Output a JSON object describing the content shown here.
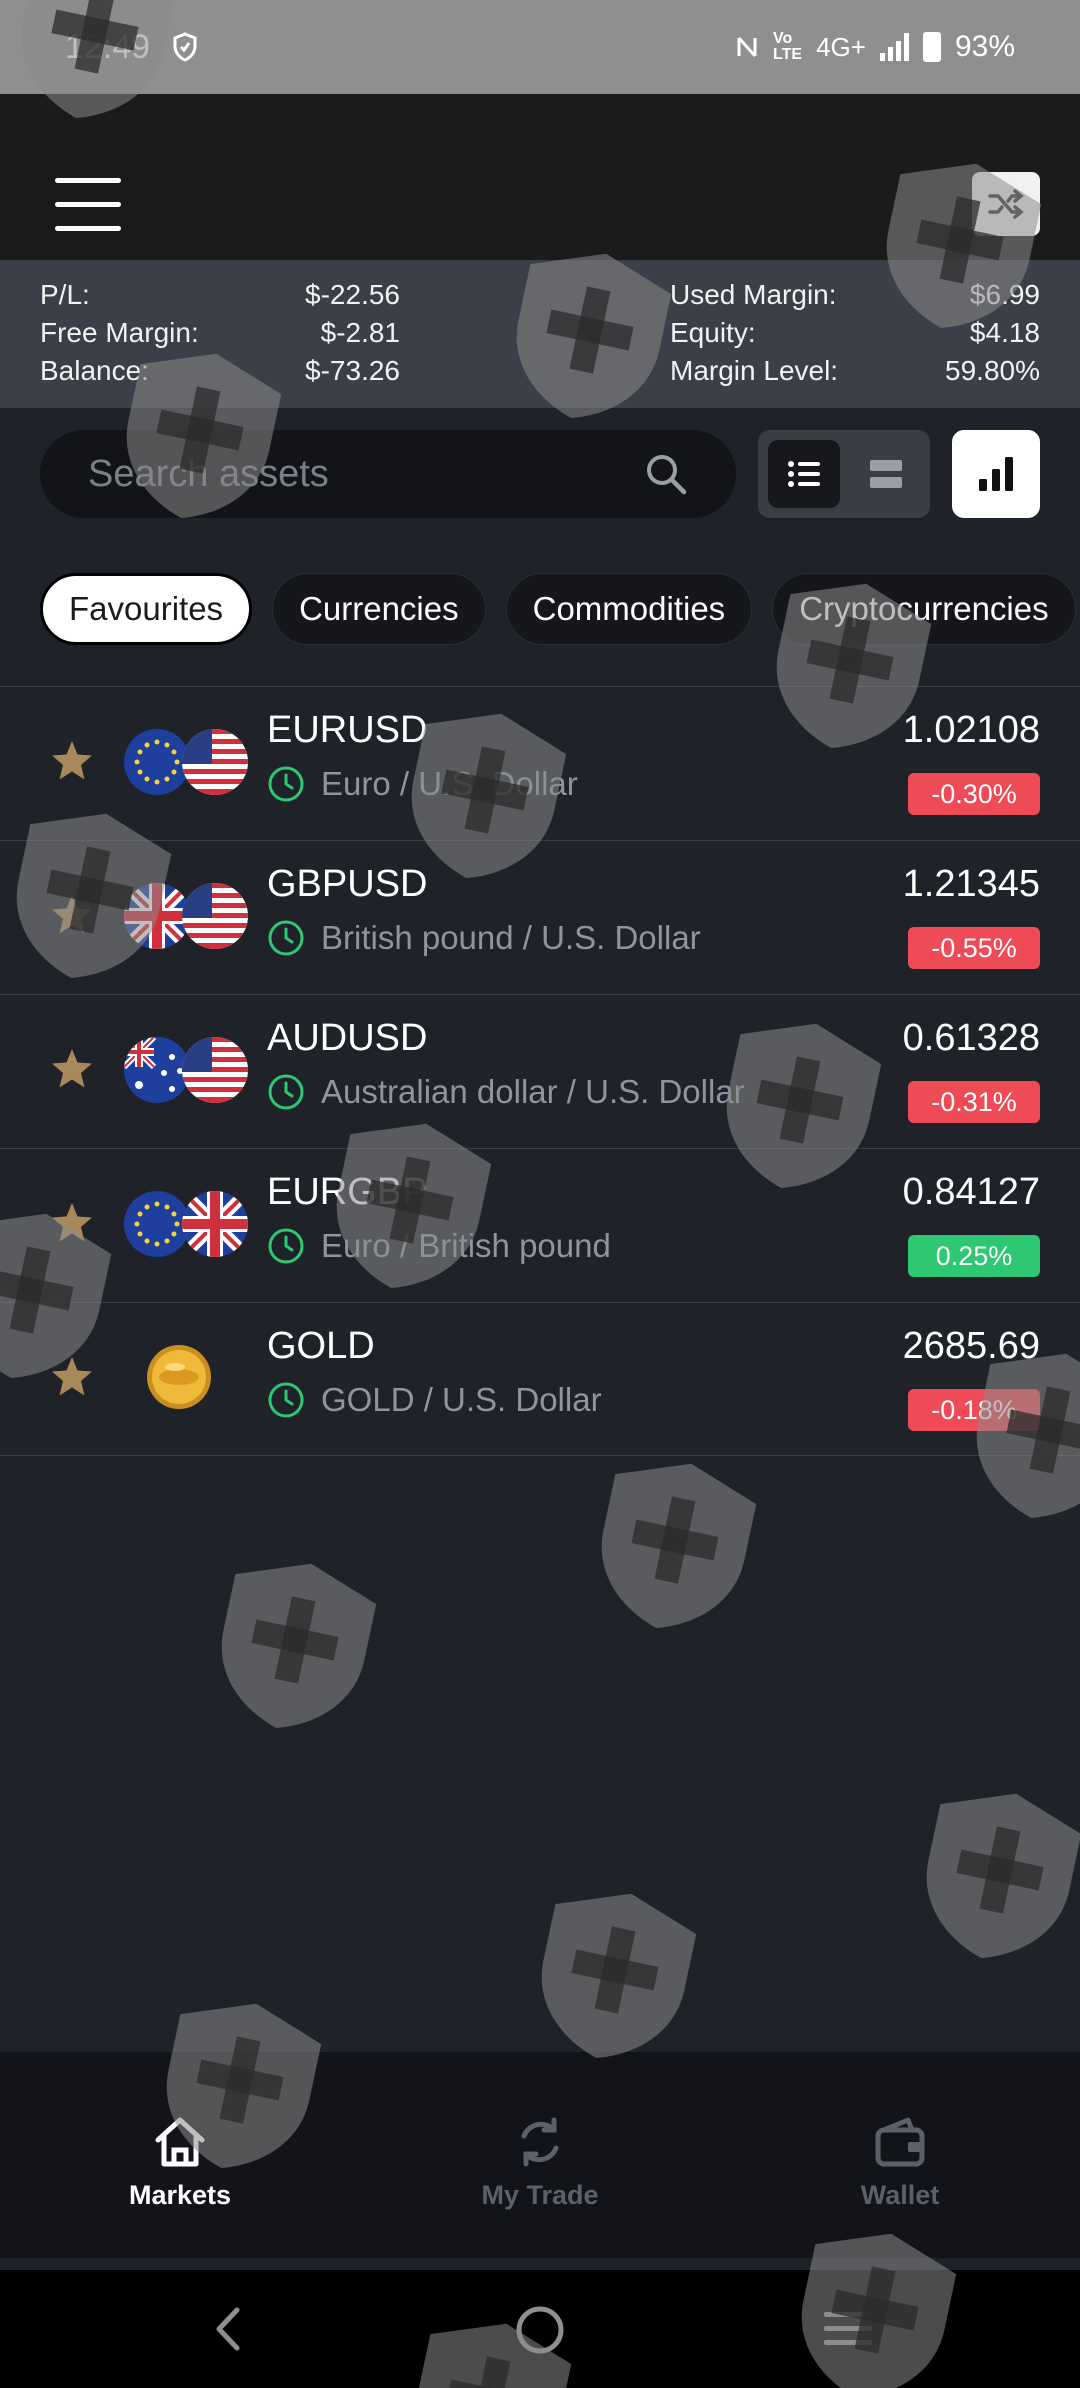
{
  "status_bar": {
    "time": "12:49",
    "network": "4G+",
    "battery": "93%"
  },
  "account": {
    "left": [
      {
        "label": "P/L:",
        "value": "$-22.56"
      },
      {
        "label": "Free Margin:",
        "value": "$-2.81"
      },
      {
        "label": "Balance:",
        "value": "$-73.26"
      }
    ],
    "right": [
      {
        "label": "Used Margin:",
        "value": "$6.99"
      },
      {
        "label": "Equity:",
        "value": "$4.18"
      },
      {
        "label": "Margin Level:",
        "value": "59.80%"
      }
    ]
  },
  "search": {
    "placeholder": "Search assets"
  },
  "tabs": [
    {
      "label": "Favourites",
      "active": true
    },
    {
      "label": "Currencies",
      "active": false
    },
    {
      "label": "Commodities",
      "active": false
    },
    {
      "label": "Cryptocurrencies",
      "active": false
    }
  ],
  "assets": [
    {
      "symbol": "EURUSD",
      "description": "Euro / U.S. Dollar",
      "price": "1.02108",
      "change": "-0.30%",
      "direction": "down"
    },
    {
      "symbol": "GBPUSD",
      "description": "British pound / U.S. Dollar",
      "price": "1.21345",
      "change": "-0.55%",
      "direction": "down"
    },
    {
      "symbol": "AUDUSD",
      "description": "Australian dollar / U.S. Dollar",
      "price": "0.61328",
      "change": "-0.31%",
      "direction": "down"
    },
    {
      "symbol": "EURGBP",
      "description": "Euro / British pound",
      "price": "0.84127",
      "change": "0.25%",
      "direction": "up"
    },
    {
      "symbol": "GOLD",
      "description": "GOLD / U.S. Dollar",
      "price": "2685.69",
      "change": "-0.18%",
      "direction": "down"
    }
  ],
  "bottom_nav": {
    "markets": "Markets",
    "my_trade": "My Trade",
    "wallet": "Wallet"
  },
  "colors": {
    "background": "#1f2229",
    "negative": "#ef4b57",
    "positive": "#2ec772",
    "clock": "#2ec772",
    "star": "#a9895a"
  }
}
